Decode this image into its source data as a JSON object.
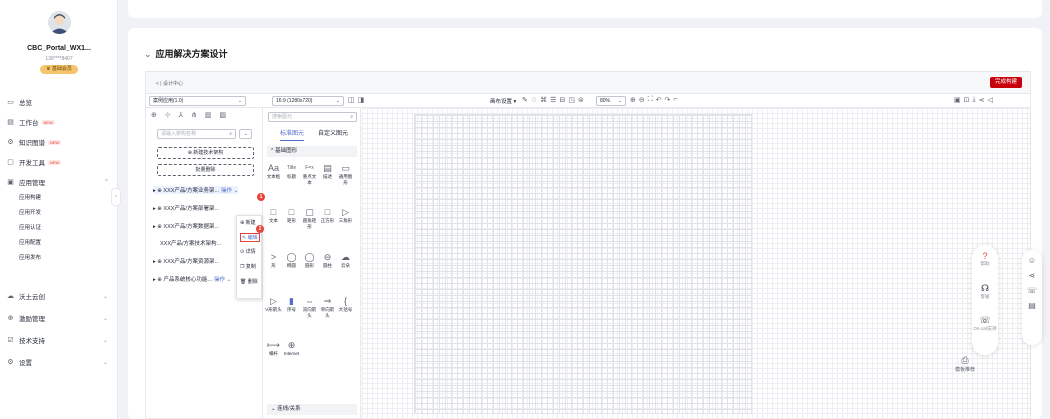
{
  "sidebar": {
    "username": "CBC_Portal_WX1...",
    "phone": "139****8407",
    "member_badge": "♛ 基础会员",
    "items": [
      {
        "label": "总览",
        "icon": "overview-icon",
        "glyph": "▭",
        "new": "",
        "chev": ""
      },
      {
        "label": "工作台",
        "icon": "workbench-icon",
        "glyph": "▤",
        "new": "NEW",
        "chev": ""
      },
      {
        "label": "知识图谱",
        "icon": "knowledge-icon",
        "glyph": "⚙",
        "new": "NEW",
        "chev": ""
      },
      {
        "label": "开发工具",
        "icon": "devtools-icon",
        "glyph": "▢",
        "new": "NEW",
        "chev": ""
      },
      {
        "label": "应用管理",
        "icon": "app-manage-icon",
        "glyph": "▣",
        "new": "",
        "chev": "^"
      },
      {
        "label": "沃土云创",
        "icon": "cloud-icon",
        "glyph": "☁",
        "new": "",
        "chev": "⌄"
      },
      {
        "label": "激励管理",
        "icon": "incentive-icon",
        "glyph": "⊕",
        "new": "",
        "chev": "⌄"
      },
      {
        "label": "技术支持",
        "icon": "support-icon",
        "glyph": "☑",
        "new": "",
        "chev": "⌄"
      },
      {
        "label": "设置",
        "icon": "settings-icon",
        "glyph": "⚙",
        "new": "",
        "chev": "⌄"
      }
    ],
    "sub_items": [
      "应用构建",
      "应用开发",
      "应用认证",
      "应用配置",
      "应用发布"
    ],
    "collapse": "‹"
  },
  "page": {
    "title": "应用解决方案设计",
    "back": "< | 设计中心",
    "finish": "完成构建"
  },
  "toolbar": {
    "case_select": "案例应用(1.0)",
    "ratio_select": "16:9 (1280x720)",
    "canvas_settings": "画布设置 ▾",
    "zoom": "80%"
  },
  "left_panel": {
    "search_placeholder": "请输入架构名称",
    "new_arch": "⊕ 新建技术架构",
    "batch_delete": "批量删除",
    "tree": [
      {
        "label": "▸ ⊕ XXX产品/方案业务架...",
        "ops": "操作 ⌄"
      },
      {
        "label": "▸ ⊕ XXX产品/方案部署架...",
        "ops": ""
      },
      {
        "label": "▸ ⊕ XXX产品/方案数据架...",
        "ops": ""
      },
      {
        "label": "XXX产品/方案技术架构...",
        "ops": ""
      },
      {
        "label": "▸ ⊕ XXX产品/方案资源架...",
        "ops": ""
      },
      {
        "label": "▸ ⊕ 产品系统核心功能...",
        "ops": "操作 ⌄"
      }
    ]
  },
  "context_menu": {
    "items": [
      "⊕ 新建",
      "✎ 编辑",
      "⊙ 详情",
      "❐ 复制",
      "🗑 删除"
    ],
    "step1": "1",
    "step2": "2"
  },
  "mid_panel": {
    "search_placeholder": "搜索图元",
    "tab_standard": "标准图元",
    "tab_custom": "自定义图元",
    "section_basic": "^ 基础图形",
    "section_lines": "⌄ 连线/关系",
    "row1": [
      "文本框",
      "标题",
      "重点文本",
      "描述",
      "通用图形"
    ],
    "row1_glyphs": [
      "Aa",
      "Title",
      "F=x",
      "▤",
      "▭"
    ],
    "row2": [
      "文本",
      "矩形",
      "圆角矩形",
      "正方形",
      "三角形"
    ],
    "row2_glyphs": [
      "□",
      "□",
      "▢",
      "□",
      "▷"
    ],
    "row3": [
      "形",
      "椭圆",
      "圆形",
      "圆柱",
      "云朵"
    ],
    "row3_glyphs": [
      ">",
      "◯",
      "◯",
      "⊖",
      "☁"
    ],
    "row4": [
      "V形箭头",
      "序号",
      "双向箭头",
      "单向箭头",
      "大括号"
    ],
    "row4_glyphs": [
      "▷",
      "▮",
      "⇔",
      "⇒",
      "{"
    ],
    "row5": [
      "横杆",
      "Internet"
    ],
    "row5_glyphs": [
      "⟼",
      "⊕"
    ]
  },
  "right": {
    "template_rec": "模板推荐",
    "float": [
      {
        "label": "帮助",
        "glyph": "?"
      },
      {
        "label": "客服",
        "glyph": "☊"
      },
      {
        "label": "On-call支持",
        "glyph": "☏"
      }
    ]
  }
}
